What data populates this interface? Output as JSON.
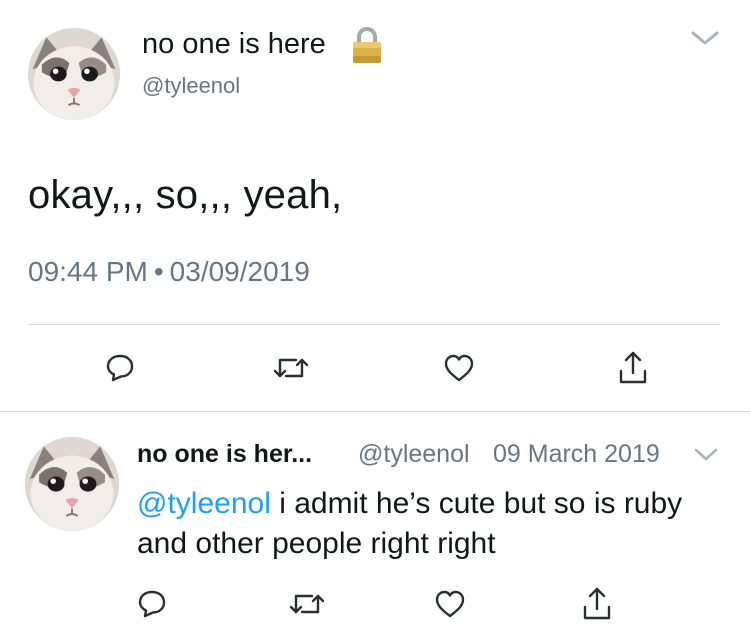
{
  "colors": {
    "text": "#14171a",
    "secondary": "#657786",
    "link": "#1da1f2",
    "divider": "#d9dde0",
    "icon": "#2a2f33",
    "lock_gold": "#d9b24a"
  },
  "tweet": {
    "display_name": "no one is here",
    "protected_icon": "lock-icon",
    "handle": "@tyleenol",
    "text": "okay,,, so,,, yeah,",
    "time": "09:44 PM",
    "separator": "•",
    "date": "03/09/2019",
    "menu_icon": "chevron-down-icon",
    "actions": [
      "reply-icon",
      "retweet-icon",
      "like-icon",
      "share-icon"
    ]
  },
  "reply": {
    "display_name": "no one is her...",
    "handle": "@tyleenol",
    "date": "09 March 2019",
    "menu_icon": "chevron-down-icon",
    "mention": "@tyleenol",
    "text": " i admit he’s cute but so is ruby and other people right right",
    "actions": [
      "reply-icon",
      "retweet-icon",
      "like-icon",
      "share-icon"
    ]
  }
}
